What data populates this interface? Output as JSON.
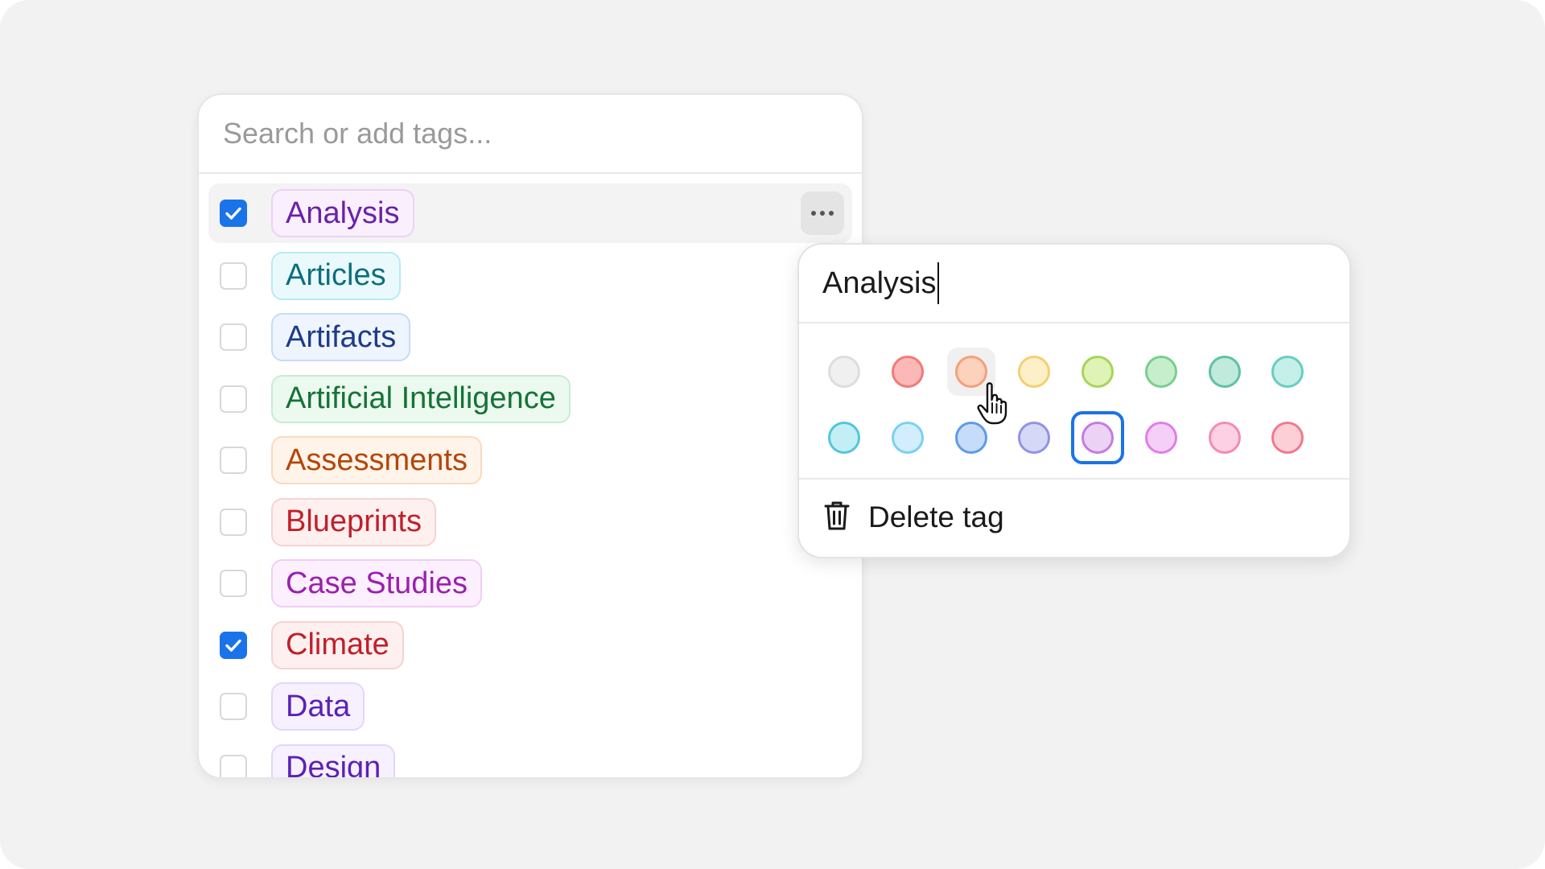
{
  "search": {
    "placeholder": "Search or add tags..."
  },
  "tags": [
    {
      "label": "Analysis",
      "checked": true,
      "text": "#6b21a8",
      "bg": "#faf0fd",
      "border": "#ecd2f5"
    },
    {
      "label": "Articles",
      "checked": false,
      "text": "#0e6e7e",
      "bg": "#eafafc",
      "border": "#b6ecf3"
    },
    {
      "label": "Artifacts",
      "checked": false,
      "text": "#1e3a8a",
      "bg": "#eef5fe",
      "border": "#c4dcf7"
    },
    {
      "label": "Artificial Intelligence",
      "checked": false,
      "text": "#157337",
      "bg": "#ecf9ef",
      "border": "#c8ecd3"
    },
    {
      "label": "Assessments",
      "checked": false,
      "text": "#b4460a",
      "bg": "#fff4ea",
      "border": "#fbd9bd"
    },
    {
      "label": "Blueprints",
      "checked": false,
      "text": "#c0202a",
      "bg": "#fff0f0",
      "border": "#f8d2d2"
    },
    {
      "label": "Case Studies",
      "checked": false,
      "text": "#9b1fb0",
      "bg": "#fcf0fe",
      "border": "#f1cdf7"
    },
    {
      "label": "Climate",
      "checked": true,
      "text": "#c0202a",
      "bg": "#fff0f0",
      "border": "#f8d2d2"
    },
    {
      "label": "Data",
      "checked": false,
      "text": "#5b21b6",
      "bg": "#f7f1ff",
      "border": "#e3d6fa"
    },
    {
      "label": "Design",
      "checked": false,
      "text": "#5b21b6",
      "bg": "#f7f1ff",
      "border": "#e3d6fa"
    }
  ],
  "popover": {
    "tag_name": "Analysis",
    "delete_label": "Delete tag",
    "swatches": [
      {
        "fill": "#f0f0f0",
        "stroke": "#dddddd",
        "state": ""
      },
      {
        "fill": "#fbb8b6",
        "stroke": "#f07b78",
        "state": ""
      },
      {
        "fill": "#fdd2bc",
        "stroke": "#f3a07c",
        "state": "hovered"
      },
      {
        "fill": "#fdf0c8",
        "stroke": "#f5cf70",
        "state": ""
      },
      {
        "fill": "#def3b5",
        "stroke": "#a8d459",
        "state": ""
      },
      {
        "fill": "#c6eecd",
        "stroke": "#78cf8c",
        "state": ""
      },
      {
        "fill": "#c0eadc",
        "stroke": "#5fc2a2",
        "state": ""
      },
      {
        "fill": "#c5efe9",
        "stroke": "#68cdbf",
        "state": ""
      },
      {
        "fill": "#c4eef5",
        "stroke": "#52c6da",
        "state": ""
      },
      {
        "fill": "#d2eefc",
        "stroke": "#7ccff2",
        "state": ""
      },
      {
        "fill": "#c6dcfb",
        "stroke": "#5f9be8",
        "state": ""
      },
      {
        "fill": "#d6d8f8",
        "stroke": "#8f95e0",
        "state": ""
      },
      {
        "fill": "#ecd3f6",
        "stroke": "#c27de0",
        "state": "selected"
      },
      {
        "fill": "#f6cff8",
        "stroke": "#df7eea",
        "state": ""
      },
      {
        "fill": "#fdd1e3",
        "stroke": "#f28bb6",
        "state": ""
      },
      {
        "fill": "#fccfd6",
        "stroke": "#f07a8c",
        "state": ""
      }
    ]
  },
  "colors": {
    "accent": "#1a73e8"
  }
}
